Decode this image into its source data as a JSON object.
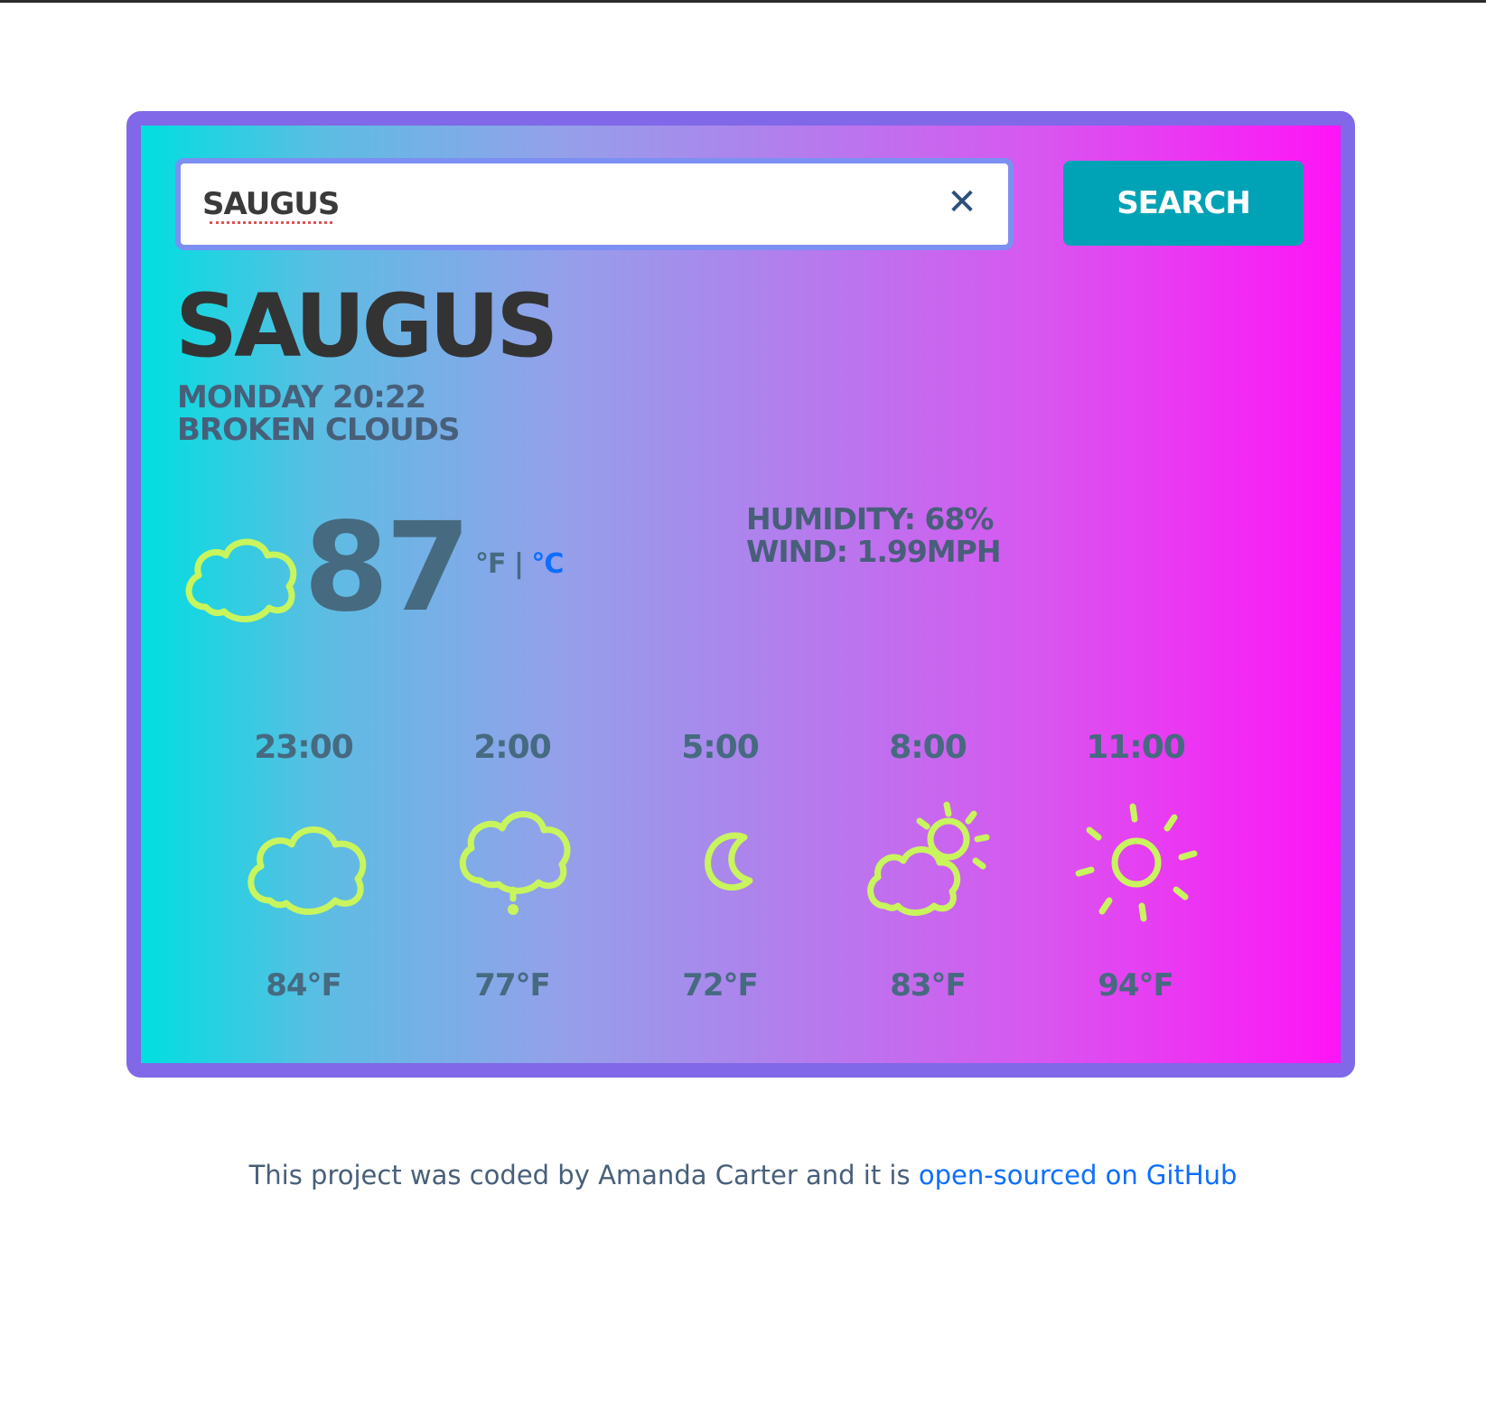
{
  "search": {
    "value": "Saugus",
    "button_label": "Search",
    "clear_icon": "close-icon"
  },
  "current": {
    "city": "Saugus",
    "datetime": "Monday 20:22",
    "description": "Broken Clouds",
    "icon": "cloud-icon",
    "temperature": "87",
    "unit_f": "°F",
    "unit_separator": " | ",
    "unit_c": "°C",
    "humidity": "Humidity: 68%",
    "wind": "Wind: 1.99mph"
  },
  "forecast": [
    {
      "time": "23:00",
      "icon": "cloud-icon",
      "temp": "84°F"
    },
    {
      "time": "2:00",
      "icon": "cloud-drizzle-icon",
      "temp": "77°F"
    },
    {
      "time": "5:00",
      "icon": "moon-icon",
      "temp": "72°F"
    },
    {
      "time": "8:00",
      "icon": "partly-cloudy-icon",
      "temp": "83°F"
    },
    {
      "time": "11:00",
      "icon": "sun-icon",
      "temp": "94°F"
    }
  ],
  "footer": {
    "text": "This project was coded by Amanda Carter and it is ",
    "link": "open-sourced on GitHub"
  },
  "colors": {
    "icon_stroke": "#c8f55d",
    "border": "#8068e8",
    "gradient_start": "#00dfe0",
    "gradient_end": "#ff14f5",
    "button": "#00a3b5"
  }
}
